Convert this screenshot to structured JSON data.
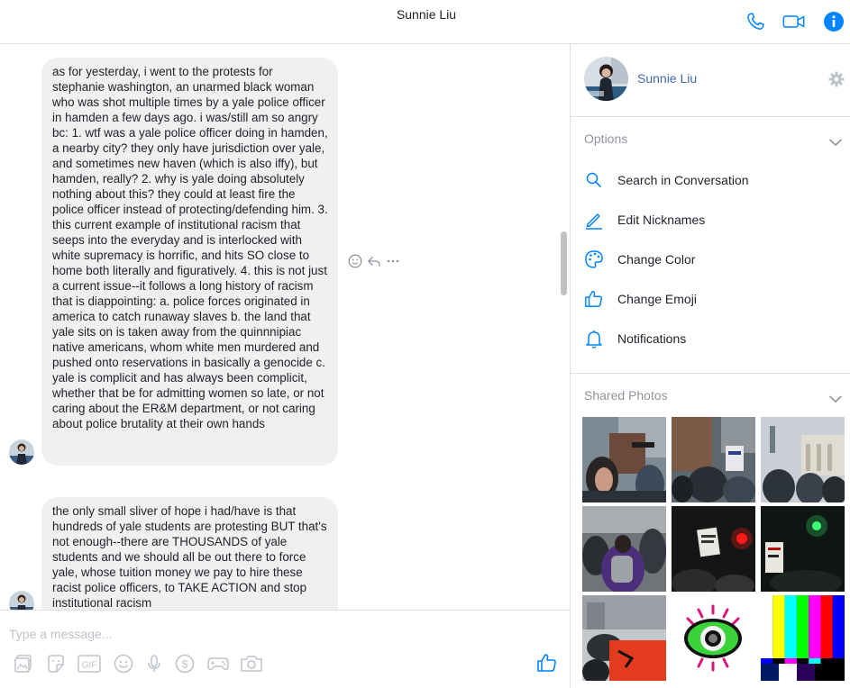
{
  "header": {
    "title": "Sunnie Liu"
  },
  "conversation": {
    "messages": [
      {
        "text": "as for yesterday, i went to the protests for stephanie washington, an unarmed black woman who was shot multiple times by a yale police officer in hamden a few days ago. i was/still am so angry bc: 1. wtf was a yale police officer doing in hamden, a nearby city? they only have jurisdiction over yale, and sometimes new haven (which is also iffy), but hamden, really? 2. why is yale doing absolutely nothing about this? they could at least fire the police officer instead of protecting/defending him. 3. this current example of institutional racism that seeps into the everyday and is interlocked with white supremacy is horrific, and hits SO close to home both literally and figuratively. 4. this is not just a current issue--it follows a long history of racism that is diappointing: a. police forces originated in america to catch runaway slaves b. the land that yale sits on is taken away from the quinnnipiac native americans, whom white men murdered and pushed onto reservations in basically a genocide c. yale is complicit and has always been complicit, whether that be for admitting women so late, or not caring about the ER&M department, or not caring about police brutality at their own hands"
      },
      {
        "text": "the only small sliver of hope i had/have is that hundreds of yale students are protesting BUT that's not enough--there are THOUSANDS of yale students and we should all be out there to force yale, whose tuition money we pay to hire these racist police officers, to TAKE ACTION and stop institutional racism"
      }
    ]
  },
  "composer": {
    "placeholder": "Type a message..."
  },
  "panel": {
    "profile_name": "Sunnie Liu",
    "options_title": "Options",
    "options": [
      {
        "label": "Search in Conversation",
        "icon": "search-icon"
      },
      {
        "label": "Edit Nicknames",
        "icon": "pencil-icon"
      },
      {
        "label": "Change Color",
        "icon": "palette-icon"
      },
      {
        "label": "Change Emoji",
        "icon": "thumbs-up-icon"
      },
      {
        "label": "Notifications",
        "icon": "bell-icon"
      }
    ],
    "shared_photos_title": "Shared Photos"
  },
  "colors": {
    "accent": "#0084ff",
    "link": "#4267b2",
    "bubble": "#f1f0f0",
    "muted": "#90949c"
  }
}
